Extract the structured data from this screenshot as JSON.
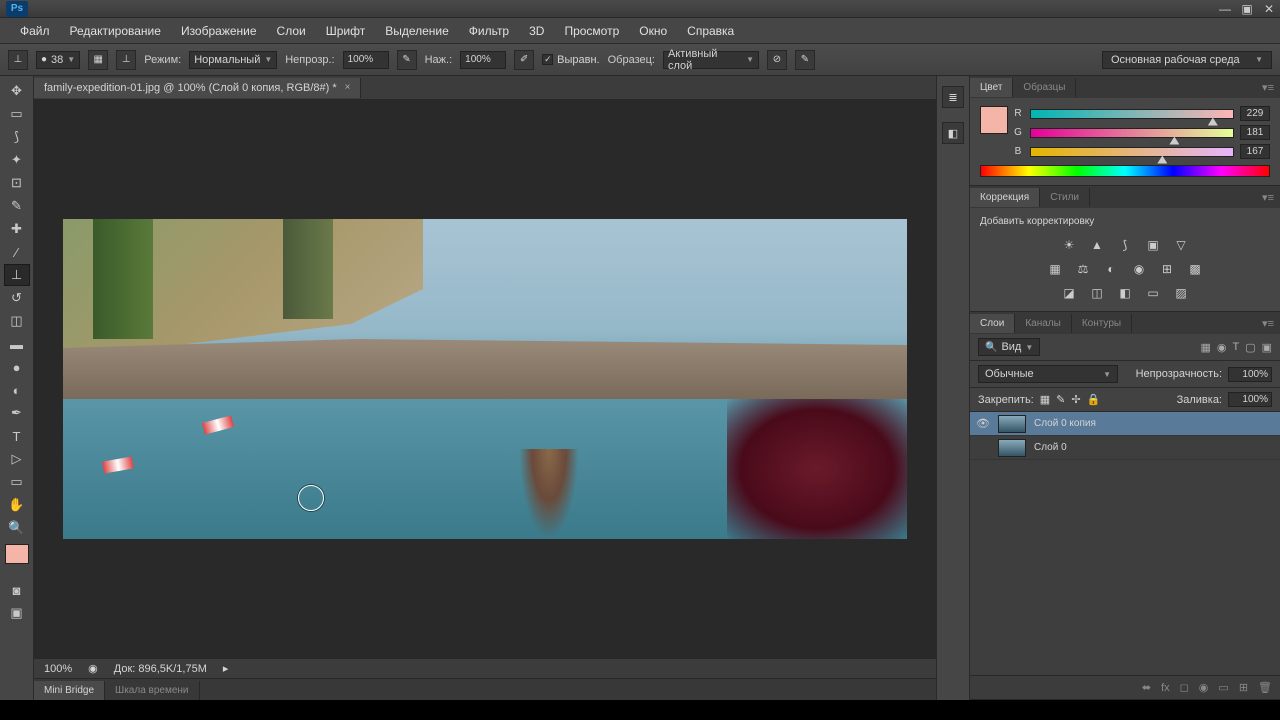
{
  "menubar": [
    "Файл",
    "Редактирование",
    "Изображение",
    "Слои",
    "Шрифт",
    "Выделение",
    "Фильтр",
    "3D",
    "Просмотр",
    "Окно",
    "Справка"
  ],
  "options": {
    "brush_size": "38",
    "mode_label": "Режим:",
    "mode_value": "Нормальный",
    "opacity_label": "Непрозр.:",
    "opacity_value": "100%",
    "flow_label": "Наж.:",
    "flow_value": "100%",
    "align_label": "Выравн.",
    "sample_label": "Образец:",
    "sample_value": "Активный слой"
  },
  "workspace_selector": "Основная рабочая среда",
  "document": {
    "tab_title": "family-expedition-01.jpg @ 100% (Слой 0 копия, RGB/8#) *"
  },
  "status": {
    "zoom": "100%",
    "doc_size": "Док: 896,5K/1,75M"
  },
  "bottom_tabs": {
    "active": "Mini Bridge",
    "inactive": "Шкала времени"
  },
  "panels": {
    "color": {
      "tab_active": "Цвет",
      "tab_inactive": "Образцы",
      "r_label": "R",
      "r_value": "229",
      "g_label": "G",
      "g_value": "181",
      "b_label": "B",
      "b_value": "167"
    },
    "adjustments": {
      "tab_active": "Коррекция",
      "tab_inactive": "Стили",
      "title": "Добавить корректировку"
    },
    "layers": {
      "tab_active": "Слои",
      "tab2": "Каналы",
      "tab3": "Контуры",
      "filter_label": "Вид",
      "blend_label": "Обычные",
      "opacity_label": "Непрозрачность:",
      "opacity_value": "100%",
      "lock_label": "Закрепить:",
      "fill_label": "Заливка:",
      "fill_value": "100%",
      "items": [
        {
          "name": "Слой 0 копия",
          "visible": true,
          "selected": true
        },
        {
          "name": "Слой 0",
          "visible": false,
          "selected": false
        }
      ]
    }
  }
}
